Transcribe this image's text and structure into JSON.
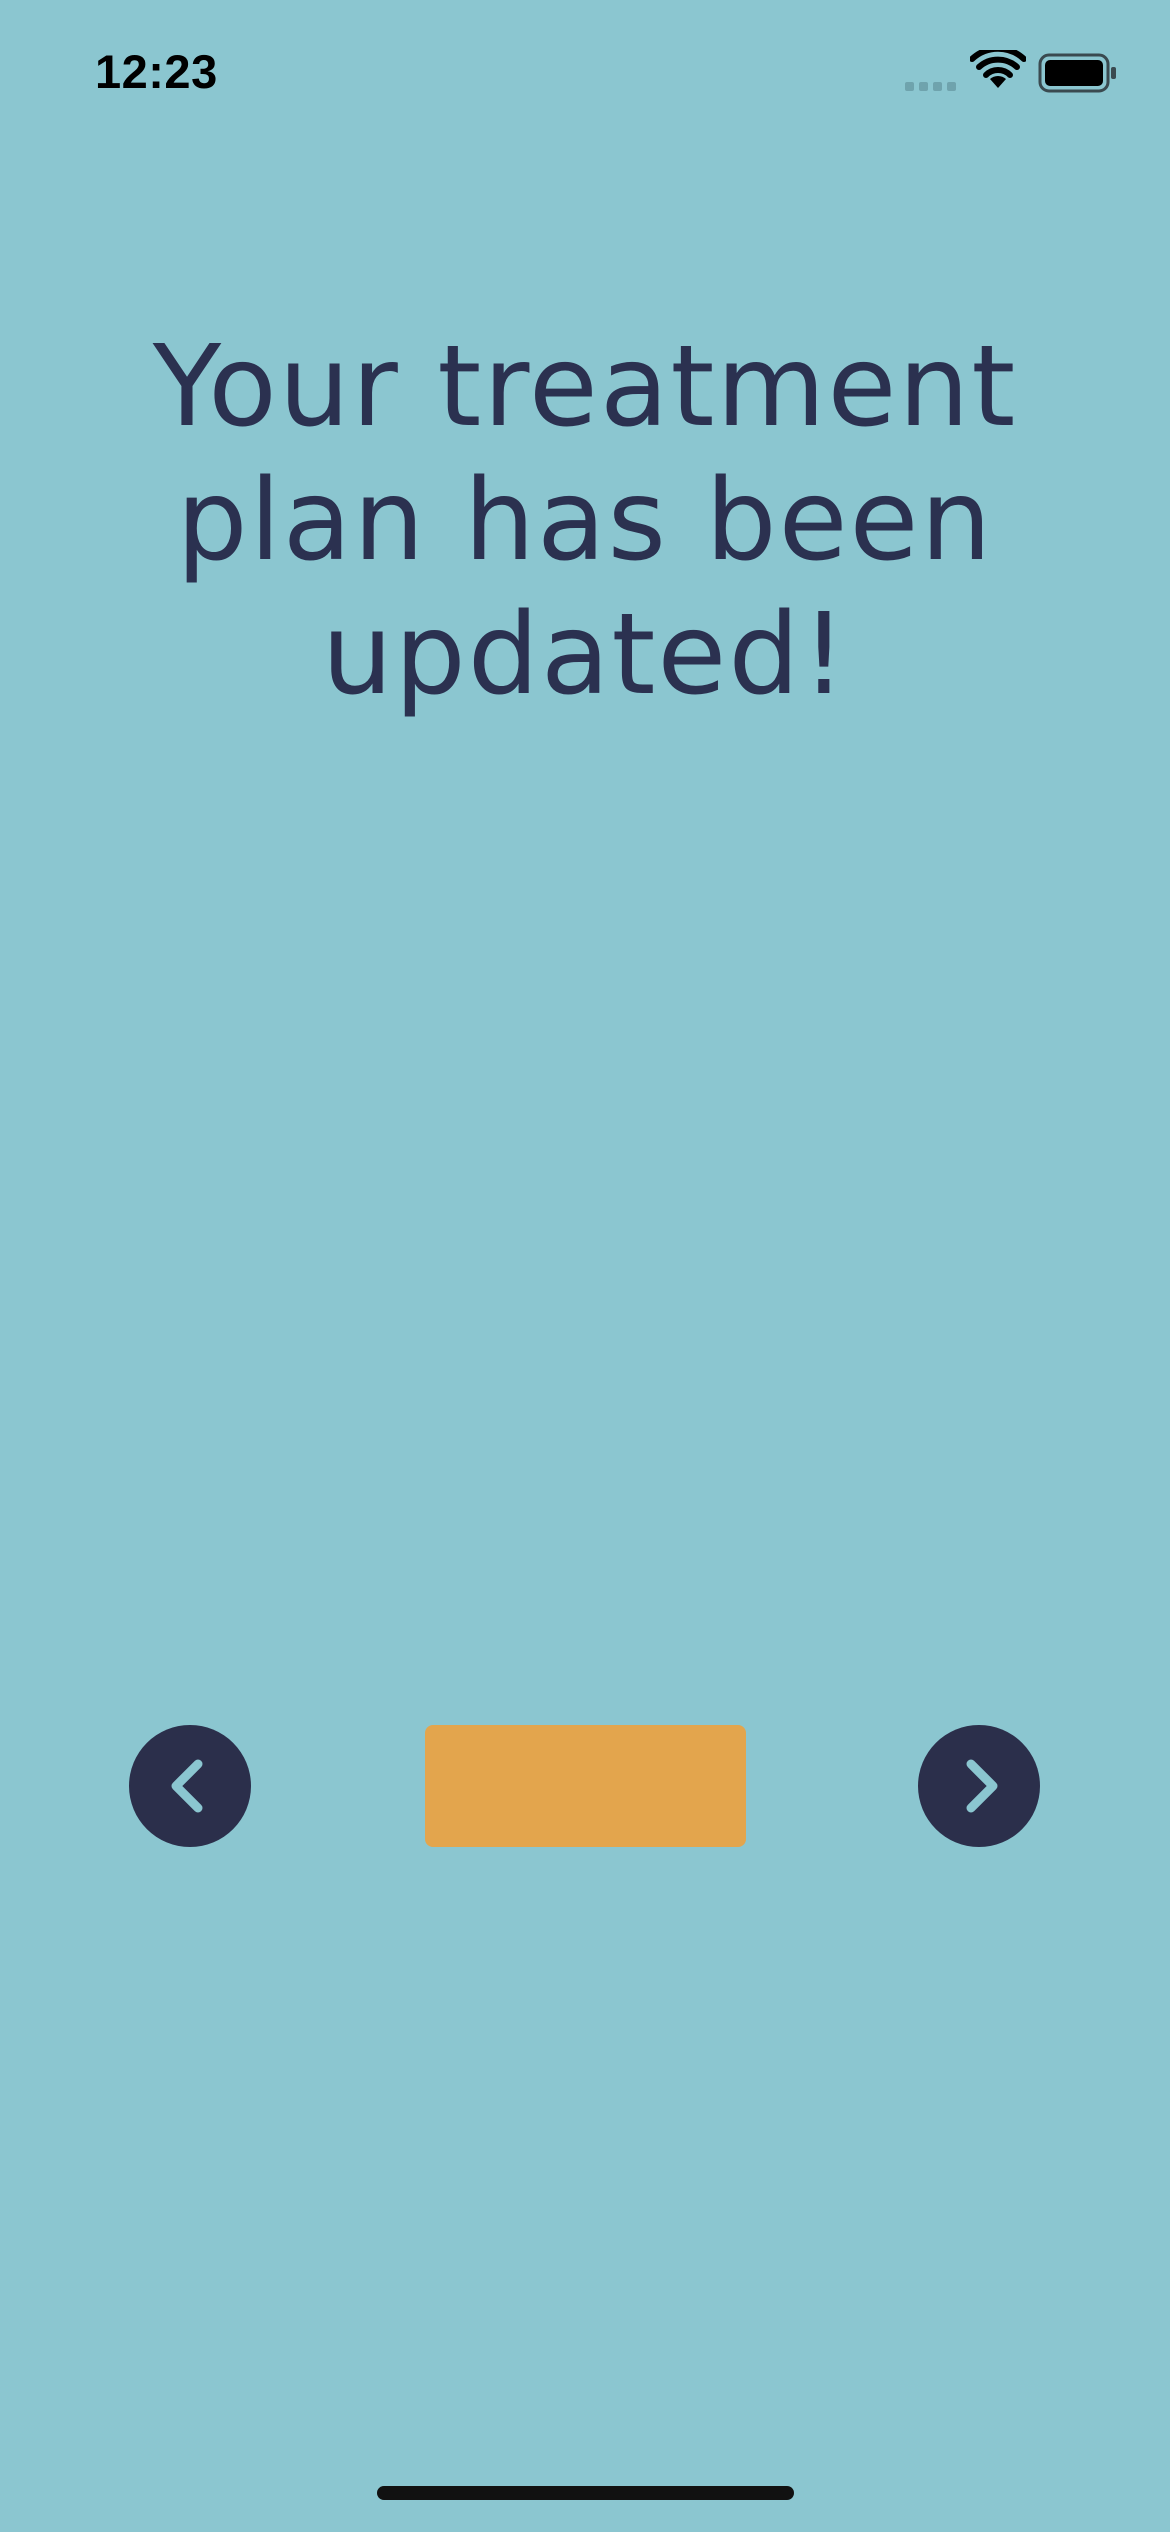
{
  "status_bar": {
    "time": "12:23",
    "icons": [
      "cellular-signal-icon",
      "wifi-icon",
      "battery-icon"
    ]
  },
  "main": {
    "headline": "Your treatment plan has been updated!"
  },
  "navigation": {
    "prev_icon": "chevron-left-icon",
    "next_icon": "chevron-right-icon",
    "center_button_label": ""
  },
  "colors": {
    "background": "#8bc6d0",
    "text": "#2b3150",
    "nav_button": "#2b2f4b",
    "accent": "#e3a54d",
    "chevron": "#8bc6d0"
  }
}
